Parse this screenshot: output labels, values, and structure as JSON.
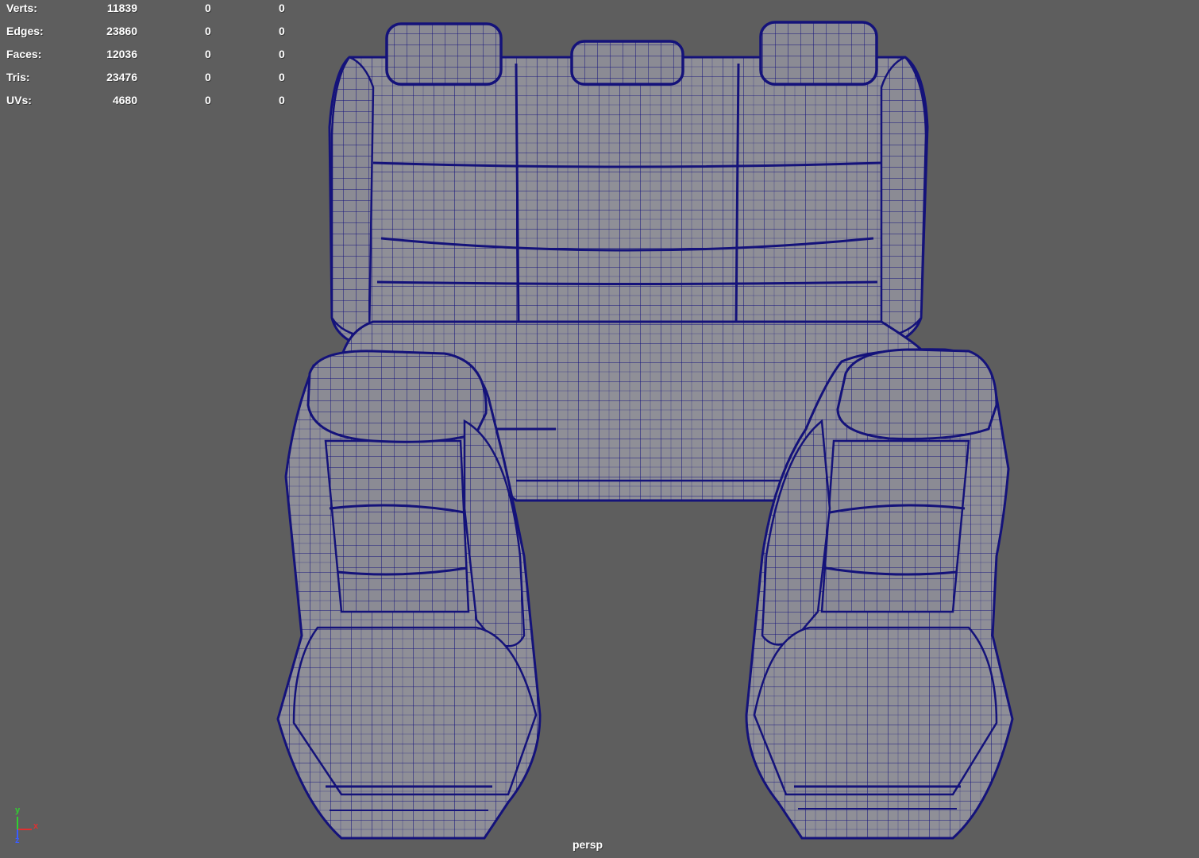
{
  "viewport": {
    "background": "#5e5e5e",
    "wire_color": "#14127a",
    "surface_color": "#8e8e96",
    "camera": "persp"
  },
  "hud": {
    "rows": [
      {
        "label": "Verts:",
        "total": "11839",
        "selected": "0",
        "selected_component": "0"
      },
      {
        "label": "Edges:",
        "total": "23860",
        "selected": "0",
        "selected_component": "0"
      },
      {
        "label": "Faces:",
        "total": "12036",
        "selected": "0",
        "selected_component": "0"
      },
      {
        "label": "Tris:",
        "total": "23476",
        "selected": "0",
        "selected_component": "0"
      },
      {
        "label": "UVs:",
        "total": "4680",
        "selected": "0",
        "selected_component": "0"
      }
    ]
  },
  "axis": {
    "x_label": "x",
    "y_label": "y",
    "z_label": "z",
    "x_color": "#e03030",
    "y_color": "#30d030",
    "z_color": "#3a5cff"
  },
  "model": {
    "objects": [
      "rear-bench-seat",
      "front-left-seat",
      "front-right-seat"
    ]
  }
}
